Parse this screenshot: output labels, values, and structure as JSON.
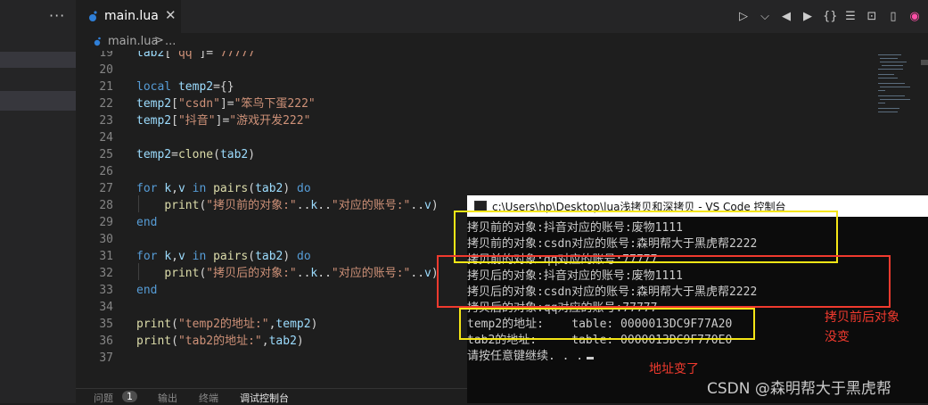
{
  "sidebar": {
    "more_label": "···"
  },
  "tab": {
    "file_name": "main.lua",
    "close_glyph": "✕"
  },
  "toolbar": {
    "run_glyph": "▷",
    "dropdown_glyph": "⌵",
    "prev_glyph": "◀",
    "next_glyph": "▶",
    "braces_glyph": "{}",
    "list_glyph": "☰",
    "terminal_glyph": "⊡",
    "split_glyph": "▯",
    "copilot_glyph": "◉"
  },
  "breadcrumb": {
    "file": "main.lua",
    "sep": ">",
    "rest": "..."
  },
  "editor": {
    "lines": [
      {
        "n": "19",
        "html": "<span class=\"var\">tab2</span>[<span class=\"str\">\"qq\"</span>]= <span class=\"str\">77777</span>"
      },
      {
        "n": "20",
        "html": ""
      },
      {
        "n": "21",
        "html": "<span class=\"kw\">local</span> <span class=\"var\">temp2</span>={}"
      },
      {
        "n": "22",
        "html": "<span class=\"var\">temp2</span>[<span class=\"str\">\"csdn\"</span>]=<span class=\"str\">\"笨鸟下蛋222\"</span>"
      },
      {
        "n": "23",
        "html": "<span class=\"var\">temp2</span>[<span class=\"str\">\"抖音\"</span>]=<span class=\"str\">\"游戏开发222\"</span>"
      },
      {
        "n": "24",
        "html": ""
      },
      {
        "n": "25",
        "html": "<span class=\"var\">temp2</span>=<span class=\"fn\">clone</span>(<span class=\"var\">tab2</span>)"
      },
      {
        "n": "26",
        "html": ""
      },
      {
        "n": "27",
        "html": "<span class=\"kw\">for</span> <span class=\"var\">k</span>,<span class=\"var\">v</span> <span class=\"kw\">in</span> <span class=\"fn\">pairs</span>(<span class=\"var\">tab2</span>) <span class=\"kw\">do</span>"
      },
      {
        "n": "28",
        "html": "    <span class=\"fn\">print</span>(<span class=\"str\">\"拷贝前的对象:\"</span>..<span class=\"var\">k</span>..<span class=\"str\">\"对应的账号:\"</span>..<span class=\"var\">v</span>)"
      },
      {
        "n": "29",
        "html": "<span class=\"kw\">end</span>"
      },
      {
        "n": "30",
        "html": ""
      },
      {
        "n": "31",
        "html": "<span class=\"kw\">for</span> <span class=\"var\">k</span>,<span class=\"var\">v</span> <span class=\"kw\">in</span> <span class=\"fn\">pairs</span>(<span class=\"var\">tab2</span>) <span class=\"kw\">do</span>"
      },
      {
        "n": "32",
        "html": "    <span class=\"fn\">print</span>(<span class=\"str\">\"拷贝后的对象:\"</span>..<span class=\"var\">k</span>..<span class=\"str\">\"对应的账号:\"</span>..<span class=\"var\">v</span>)"
      },
      {
        "n": "33",
        "html": "<span class=\"kw\">end</span>"
      },
      {
        "n": "34",
        "html": ""
      },
      {
        "n": "35",
        "html": "<span class=\"fn\">print</span>(<span class=\"str\">\"temp2的地址:\"</span>,<span class=\"var\">temp2</span>)"
      },
      {
        "n": "36",
        "html": "<span class=\"fn\">print</span>(<span class=\"str\">\"tab2的地址:\"</span>,<span class=\"var\">tab2</span>)"
      },
      {
        "n": "37",
        "html": ""
      }
    ]
  },
  "panel": {
    "tabs": [
      "问题",
      "1",
      "输出",
      "终端",
      "调试控制台"
    ]
  },
  "console": {
    "title": "c:\\Users\\hp\\Desktop\\lua浅拷贝和深拷贝 - VS Code 控制台",
    "lines": [
      "拷贝前的对象:抖音对应的账号:废物1111",
      "拷贝前的对象:csdn对应的账号:森明帮大于黑虎帮2222",
      "拷贝前的对象:qq对应的账号:77777",
      "拷贝后的对象:抖音对应的账号:废物1111",
      "拷贝后的对象:csdn对应的账号:森明帮大于黑虎帮2222",
      "拷贝后的对象:qq对应的账号:77777",
      "temp2的地址:    table: 0000013DC9F77A20",
      "tab2的地址:     table: 0000013DC9F770E0",
      "请按任意键继续. . ."
    ]
  },
  "annotations": {
    "unchanged_line1": "拷贝前后对象",
    "unchanged_line2": "没变",
    "address_changed": "地址变了"
  },
  "watermark": "CSDN @森明帮大于黑虎帮",
  "colors": {
    "editor_bg": "#1e1e1e",
    "keyword": "#569cd6",
    "variable": "#9cdcfe",
    "string": "#ce9178",
    "function": "#dcdcaa",
    "highlight_yellow": "#f5e616",
    "highlight_red": "#f03a2e"
  }
}
